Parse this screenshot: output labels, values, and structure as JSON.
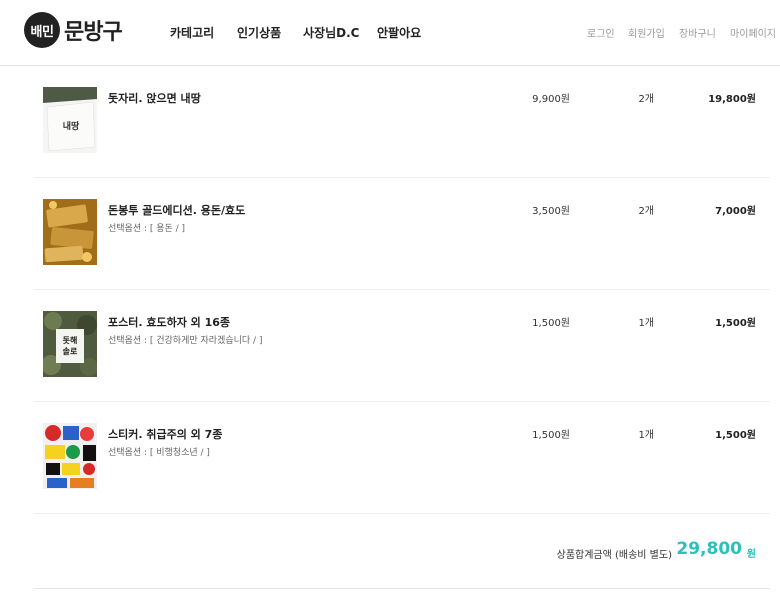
{
  "header": {
    "logo_badge": "배민",
    "logo_text": "문방구",
    "nav": [
      "카테고리",
      "인기상품",
      "사장님D.C",
      "안팔아요"
    ],
    "util": [
      "로그인",
      "회원가입",
      "장바구니",
      "마이페이지"
    ]
  },
  "cart": {
    "items": [
      {
        "name": "돗자리. 앉으면 내땅",
        "option": "",
        "price": "9,900원",
        "qty": "2개",
        "total": "19,800원",
        "thumb_text": "내땅"
      },
      {
        "name": "돈봉투 골드에디션. 용돈/효도",
        "option": "선택옵션 : [ 용돈 / ]",
        "price": "3,500원",
        "qty": "2개",
        "total": "7,000원",
        "thumb_text": ""
      },
      {
        "name": "포스터. 효도하자 외 16종",
        "option": "선택옵션 : [ 건강하게만 자라겠습니다 / ]",
        "price": "1,500원",
        "qty": "1개",
        "total": "1,500원",
        "thumb_text": "돗해 솔로"
      },
      {
        "name": "스티커. 취급주의 외 7종",
        "option": "선택옵션 : [ 비행청소년 / ]",
        "price": "1,500원",
        "qty": "1개",
        "total": "1,500원",
        "thumb_text": ""
      }
    ],
    "summary": {
      "label": "상품합계금액 (배송비 별도)",
      "value": "29,800",
      "unit": "원"
    }
  },
  "colors": {
    "accent": "#2ac1bc",
    "text": "#222222",
    "muted": "#999999",
    "divider": "#eeeeee"
  },
  "icons": [
    "logo-badge-icon"
  ]
}
